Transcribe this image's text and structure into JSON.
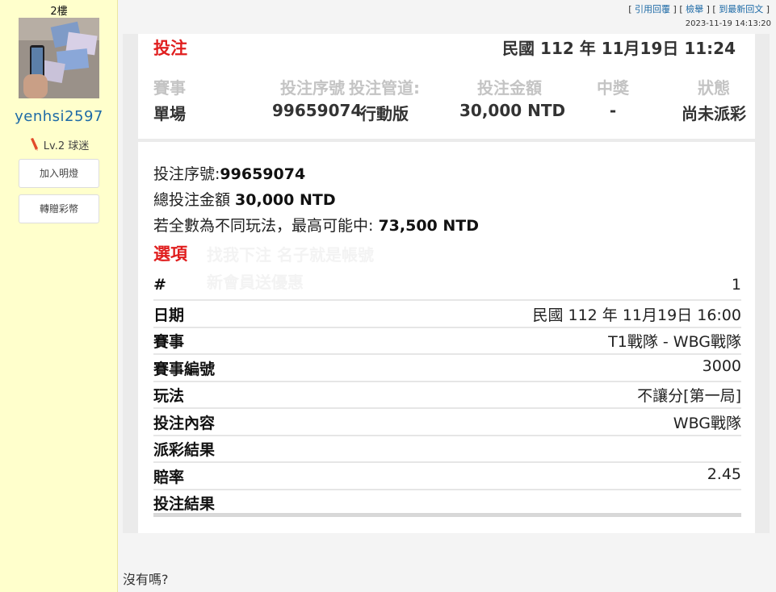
{
  "post": {
    "floor": "2樓",
    "reply_text": "沒有嗎?"
  },
  "user": {
    "name": "yenhsi2597",
    "level": "Lv.2 球迷",
    "actions": [
      "加入明燈",
      "轉贈彩幣"
    ]
  },
  "toolbar": {
    "quote_reply": "引用回覆",
    "report": "檢舉",
    "latest": "到最新回文",
    "timestamp": "2023-11-19 14:13:20"
  },
  "ticket": {
    "title": "投注",
    "datetime": "民國 112 年 11月19日 11:24",
    "headers": [
      "賽事",
      "投注序號",
      "投注管道:",
      "投注金額",
      "中獎",
      "狀態"
    ],
    "values": [
      "單場",
      "99659074",
      "行動版",
      "30,000 NTD",
      "-",
      "尚未派彩"
    ],
    "serial_label": "投注序號:",
    "serial_value": "99659074",
    "total_label": "總投注金額 ",
    "total_value": "30,000 NTD",
    "max_label": "若全數為不同玩法，最高可能中: ",
    "max_value": "73,500 NTD",
    "options_title": "選項",
    "watermark_lines": [
      "找我下注 名子就是帳號",
      "新會員送優惠"
    ],
    "details": [
      {
        "key": "#",
        "value": "1"
      },
      {
        "key": "日期",
        "value": "民國 112 年 11月19日 16:00"
      },
      {
        "key": "賽事",
        "value": "T1戰隊 - WBG戰隊"
      },
      {
        "key": "賽事編號",
        "value": "3000"
      },
      {
        "key": "玩法",
        "value": "不讓分[第一局]"
      },
      {
        "key": "投注內容",
        "value": "WBG戰隊"
      },
      {
        "key": "派彩結果",
        "value": ""
      },
      {
        "key": "賠率",
        "value": "2.45"
      },
      {
        "key": "投注結果",
        "value": ""
      }
    ]
  },
  "colors": {
    "accent_red": "#e01e1e",
    "link_blue": "#1d6aa6",
    "sidebar_bg": "#ffffcc"
  }
}
